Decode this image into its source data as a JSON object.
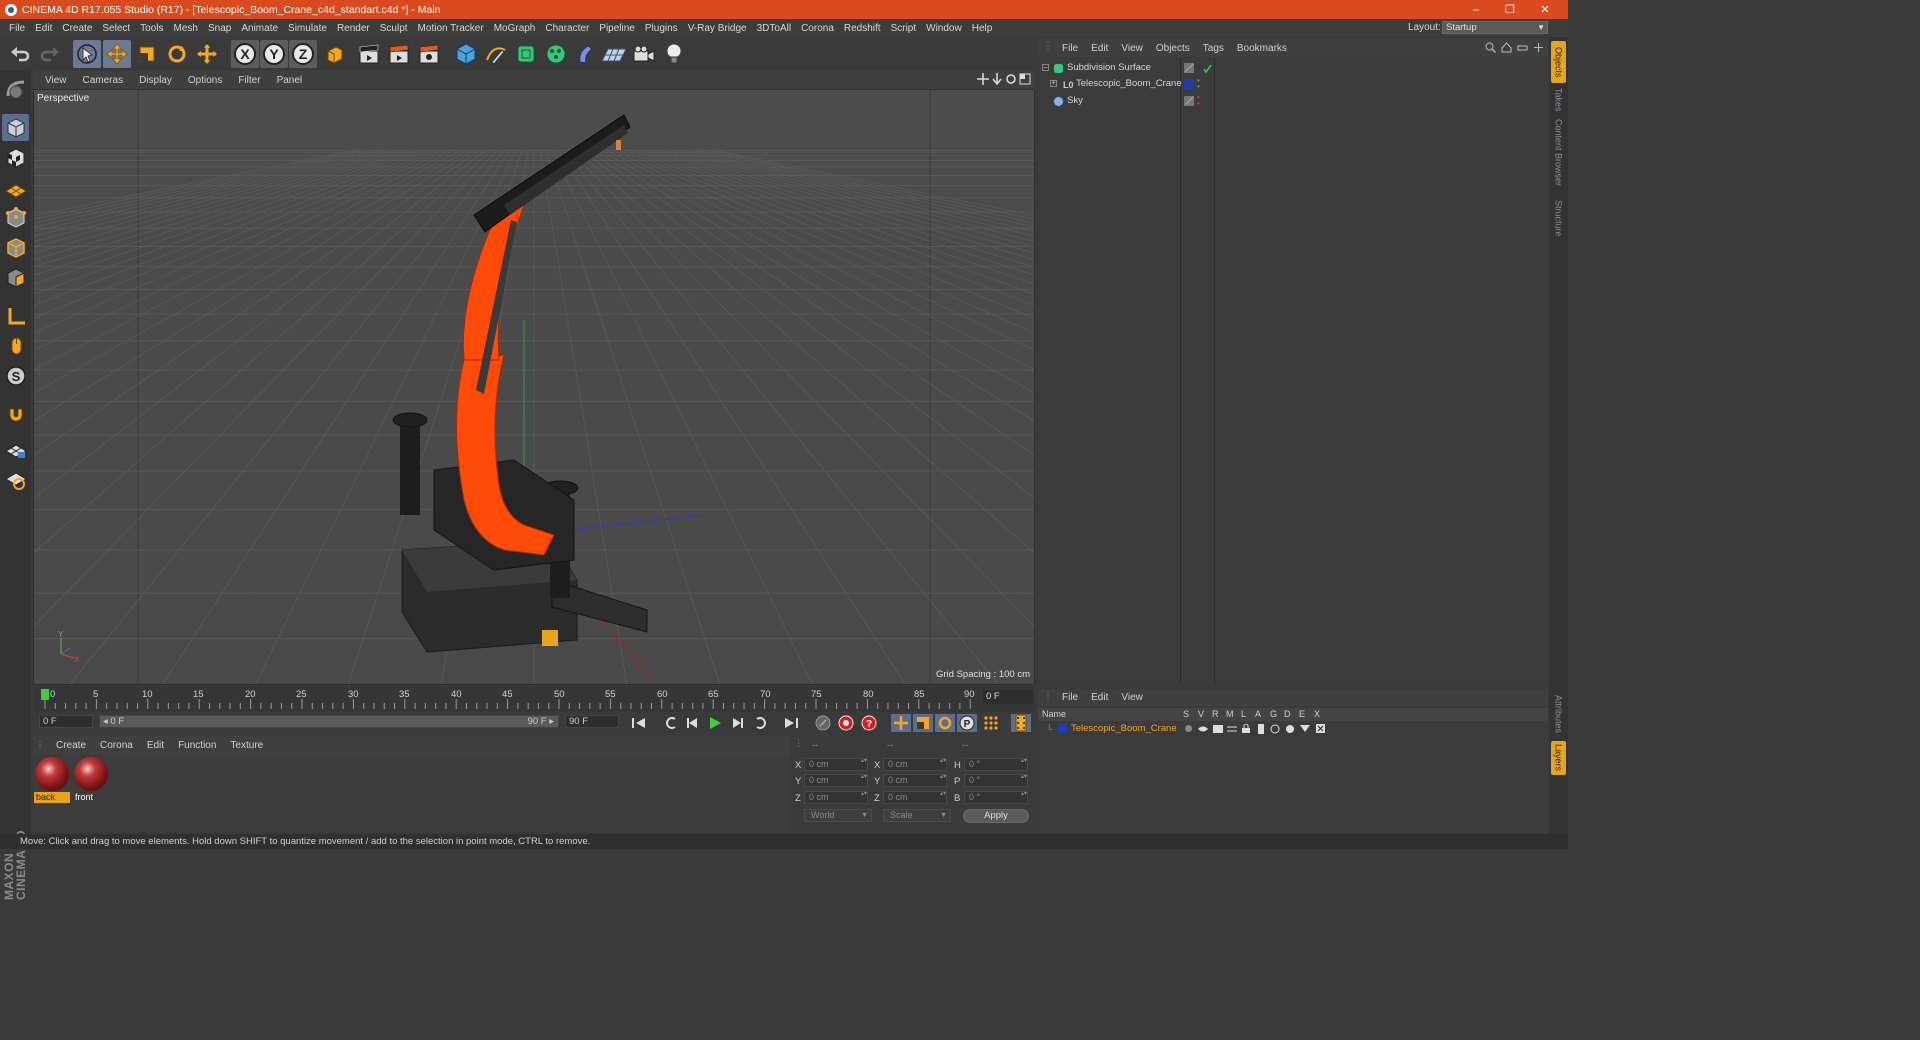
{
  "titlebar": {
    "title": "CINEMA 4D R17.055 Studio (R17) - [Telescopic_Boom_Crane_c4d_standart.c4d *] - Main",
    "minimize": "–",
    "restore": "❐",
    "close": "✕"
  },
  "menubar": {
    "items": [
      "File",
      "Edit",
      "Create",
      "Select",
      "Tools",
      "Mesh",
      "Snap",
      "Animate",
      "Simulate",
      "Render",
      "Sculpt",
      "Motion Tracker",
      "MoGraph",
      "Character",
      "Pipeline",
      "Plugins",
      "V-Ray Bridge",
      "3DToAll",
      "Corona",
      "Redshift",
      "Script",
      "Window",
      "Help"
    ],
    "layout_label": "Layout:",
    "layout_value": "Startup"
  },
  "viewport": {
    "menu": [
      "View",
      "Cameras",
      "Display",
      "Options",
      "Filter",
      "Panel"
    ],
    "title": "Perspective",
    "grid_spacing": "Grid Spacing : 100 cm"
  },
  "timeline": {
    "ticks": [
      "0",
      "5",
      "10",
      "15",
      "20",
      "25",
      "30",
      "35",
      "40",
      "45",
      "50",
      "55",
      "60",
      "65",
      "70",
      "75",
      "80",
      "85",
      "90"
    ],
    "current_frame": "0 F",
    "start_field": "0 F",
    "range_start": "◂ 0 F",
    "range_end": "90 F ▸",
    "end_field": "90 F"
  },
  "materials": {
    "menu": [
      "Create",
      "Corona",
      "Edit",
      "Function",
      "Texture"
    ],
    "items": [
      {
        "name": "back",
        "active": true
      },
      {
        "name": "front",
        "active": false
      }
    ]
  },
  "coordinates": {
    "header": [
      "--",
      "--",
      "--"
    ],
    "rows": [
      {
        "axis_pos": "X",
        "pos": "0 cm",
        "axis_size": "X",
        "size": "0 cm",
        "axis_rot": "H",
        "rot": "0 °"
      },
      {
        "axis_pos": "Y",
        "pos": "0 cm",
        "axis_size": "Y",
        "size": "0 cm",
        "axis_rot": "P",
        "rot": "0 °"
      },
      {
        "axis_pos": "Z",
        "pos": "0 cm",
        "axis_size": "Z",
        "size": "0 cm",
        "axis_rot": "B",
        "rot": "0 °"
      }
    ],
    "mode": "World",
    "transform": "Scale",
    "apply": "Apply"
  },
  "object_manager": {
    "menu": [
      "File",
      "Edit",
      "View",
      "Objects",
      "Tags",
      "Bookmarks"
    ],
    "objects": [
      {
        "name": "Subdivision Surface",
        "icon": "subdivision-icon"
      },
      {
        "name": "Telescopic_Boom_Crane",
        "icon": "null-object-icon"
      },
      {
        "name": "Sky",
        "icon": "sky-icon"
      }
    ]
  },
  "layer_manager": {
    "menu": [
      "File",
      "Edit",
      "View"
    ],
    "columns": [
      "Name",
      "S",
      "V",
      "R",
      "M",
      "L",
      "A",
      "G",
      "D",
      "E",
      "X"
    ],
    "layers": [
      {
        "name": "Telescopic_Boom_Crane",
        "color": "#1f3fa8"
      }
    ]
  },
  "right_tabs": [
    "Objects",
    "Takes",
    "Content Browser",
    "Structure",
    "Attributes",
    "Layers"
  ],
  "status": "Move: Click and drag to move elements. Hold down SHIFT to quantize movement / add to the selection in point mode, CTRL to remove.",
  "brand": "MAXON CINEMA 4D",
  "colors": {
    "titlebar": "#d94a1e",
    "accent": "#e8a31a",
    "crane_orange": "#ff4a0a",
    "selection_blue": "#6a7a92"
  }
}
